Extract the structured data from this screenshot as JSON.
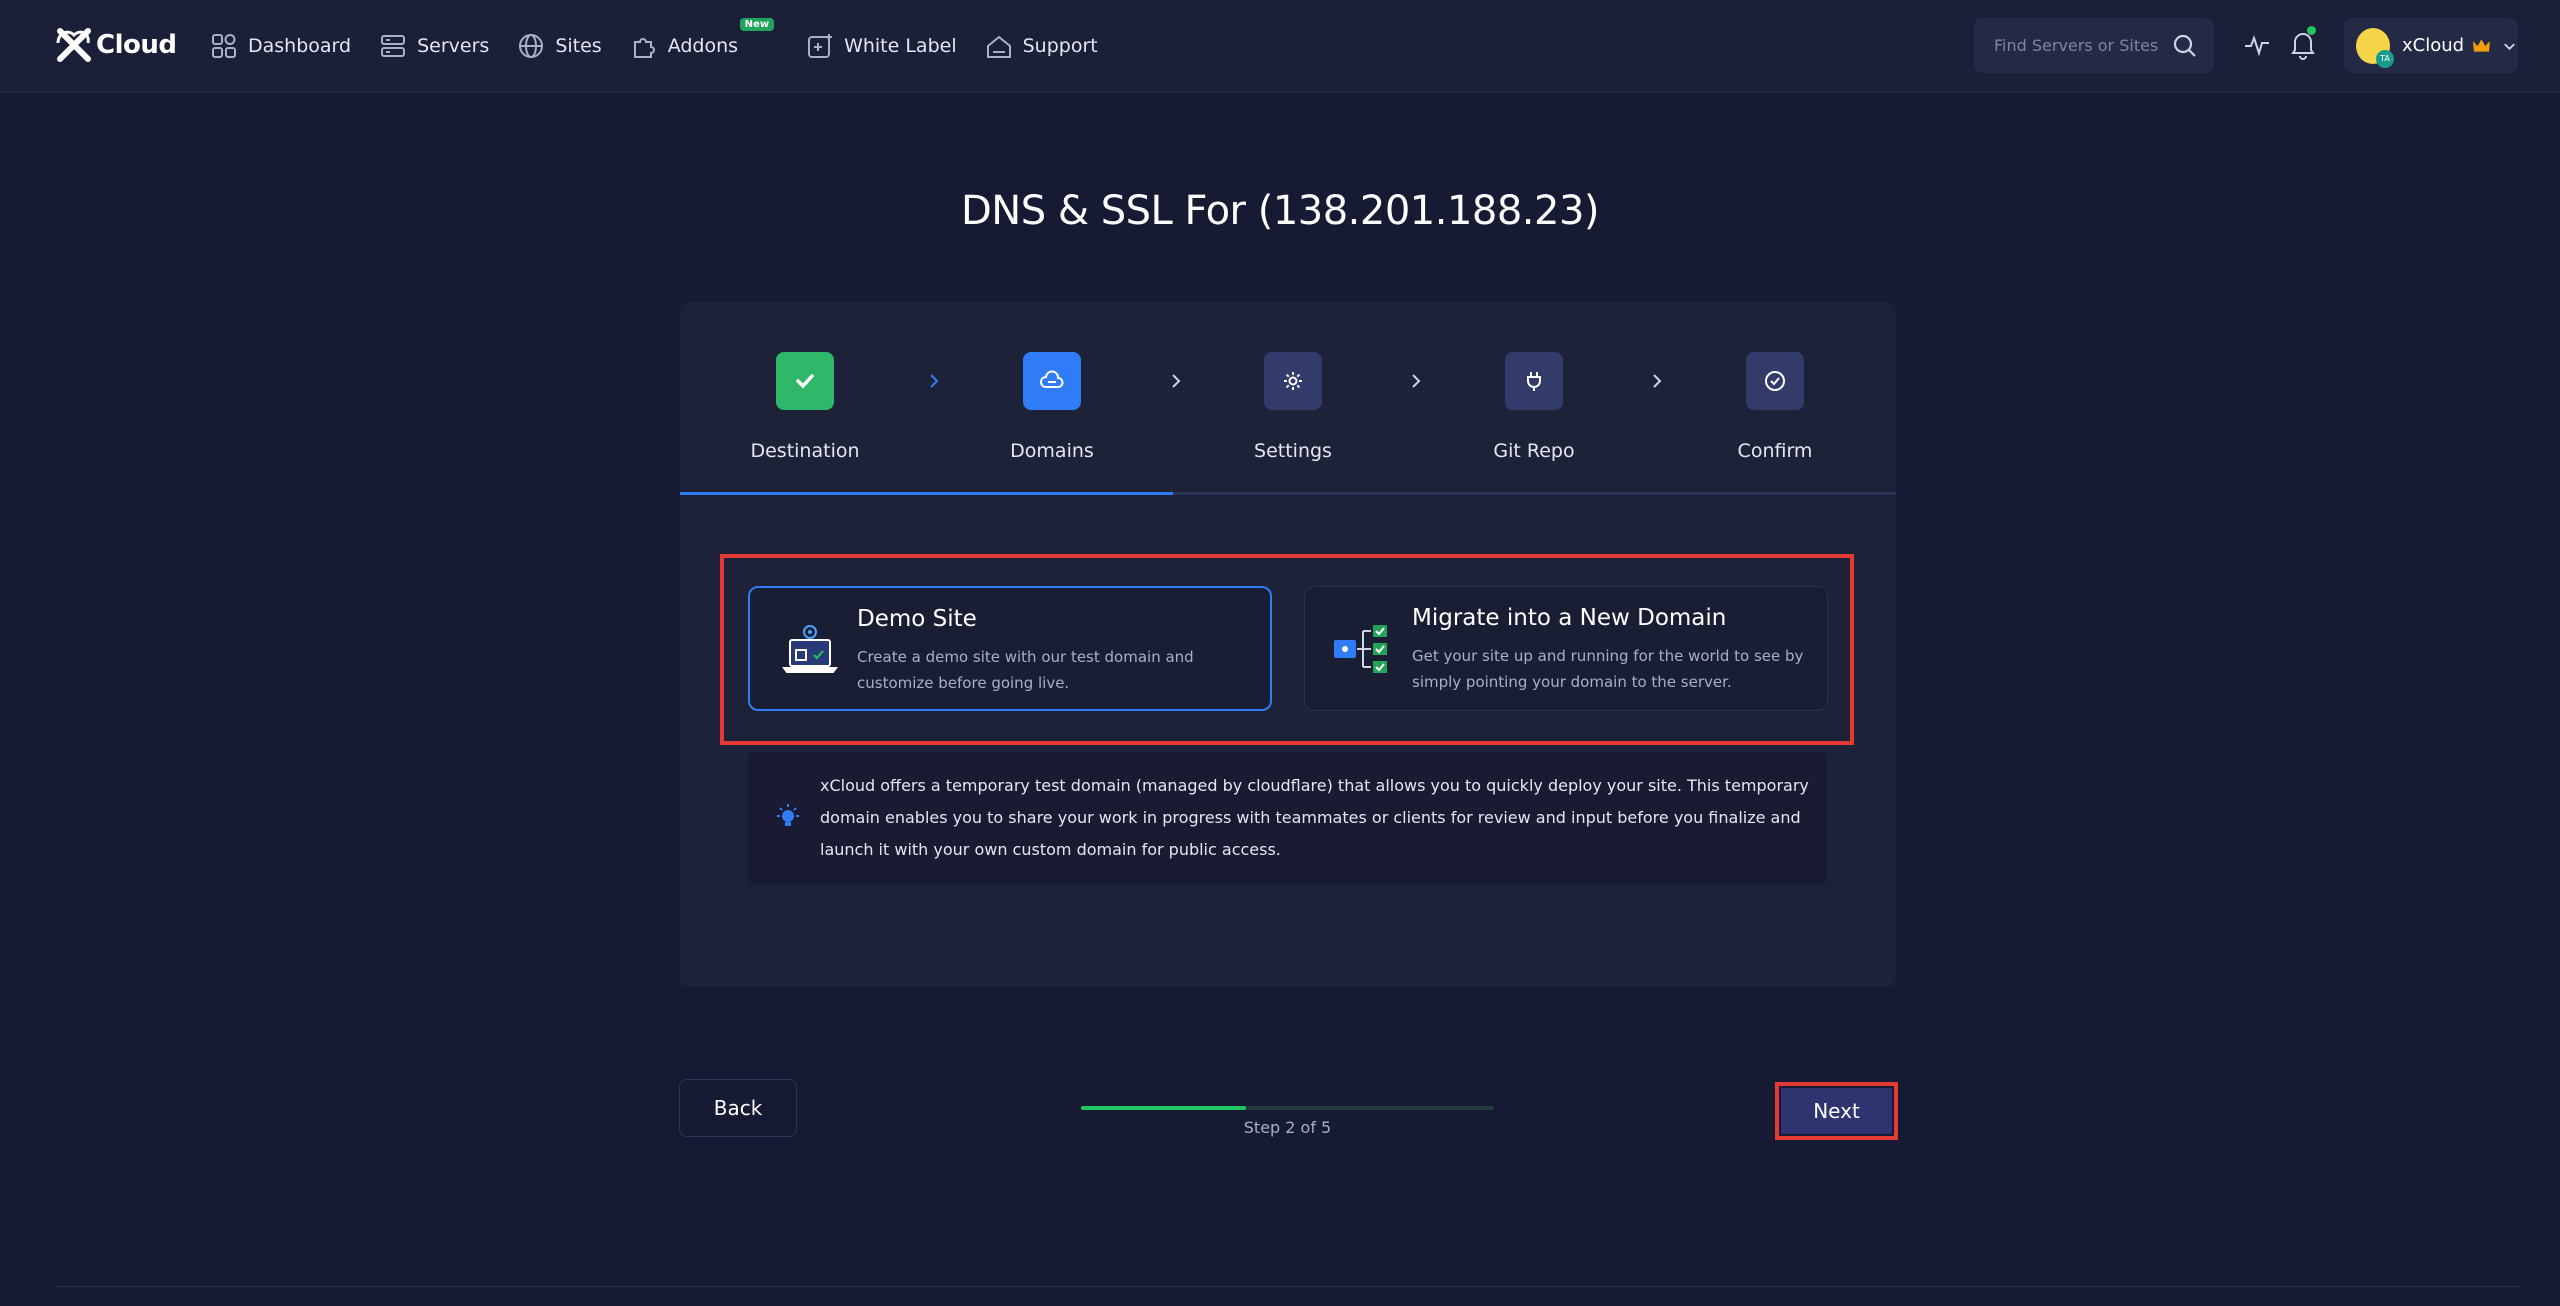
{
  "brand": {
    "name": "Cloud"
  },
  "nav": [
    {
      "label": "Dashboard",
      "icon": "dashboard-icon"
    },
    {
      "label": "Servers",
      "icon": "server-icon"
    },
    {
      "label": "Sites",
      "icon": "globe-icon"
    },
    {
      "label": "Addons",
      "icon": "puzzle-icon",
      "badge": "New"
    },
    {
      "label": "White Label",
      "icon": "white-label-icon"
    },
    {
      "label": "Support",
      "icon": "support-icon"
    }
  ],
  "search": {
    "placeholder": "Find Servers or Sites"
  },
  "account": {
    "name": "xCloud",
    "avatar_badge": "TA"
  },
  "page": {
    "title": "DNS & SSL For (138.201.188.23)"
  },
  "steps": [
    {
      "label": "Destination",
      "state": "done",
      "icon": "check-icon"
    },
    {
      "label": "Domains",
      "state": "active",
      "icon": "cloud-icon"
    },
    {
      "label": "Settings",
      "state": "pending",
      "icon": "gear-icon"
    },
    {
      "label": "Git Repo",
      "state": "pending",
      "icon": "plug-icon"
    },
    {
      "label": "Confirm",
      "state": "pending",
      "icon": "check-circle-icon"
    }
  ],
  "options": {
    "demo": {
      "title": "Demo Site",
      "description": "Create a demo site with our test domain and customize before going live.",
      "selected": true
    },
    "migrate": {
      "title": "Migrate into a New Domain",
      "description": "Get your site up and running for the world to see by simply pointing your domain to the server.",
      "selected": false
    }
  },
  "info": {
    "text": "xCloud offers a temporary test domain (managed by cloudflare) that allows you to quickly deploy your site. This temporary domain enables you to share your work in progress with teammates or clients for review and input before you finalize and launch it with your own custom domain for public access."
  },
  "footer": {
    "back_label": "Back",
    "next_label": "Next",
    "progress_label": "Step 2 of 5",
    "progress_fraction": 0.4
  },
  "colors": {
    "accent": "#2f7cf6",
    "success": "#22c55e",
    "highlight": "#e53935",
    "background": "#171a33"
  }
}
